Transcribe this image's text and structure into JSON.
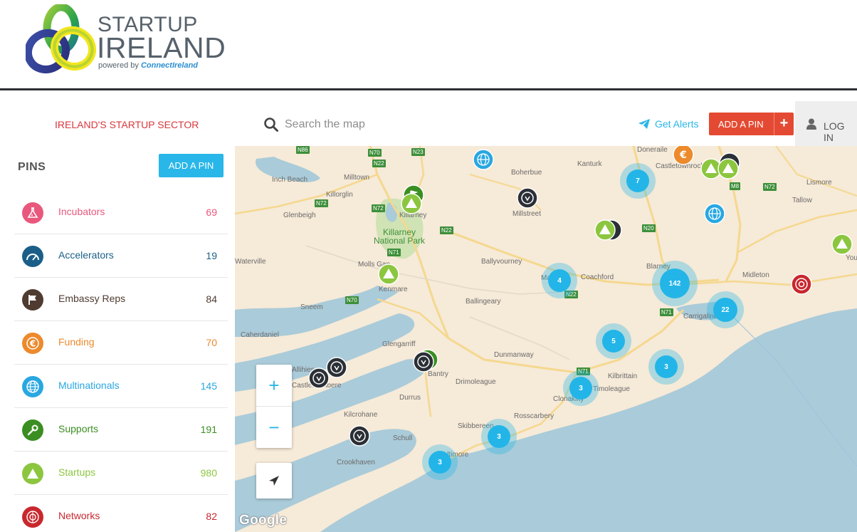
{
  "brand": {
    "line1": "STARTUP",
    "line2": "IRELAND",
    "powered_by": "powered by",
    "powered_name": "ConnectIreland"
  },
  "topbar": {
    "sector_label": "IRELAND'S STARTUP SECTOR",
    "search_placeholder": "Search the map",
    "alerts_label": "Get Alerts",
    "add_pin_label": "ADD A PIN",
    "add_pin_plus": "+",
    "login_label": "LOG IN"
  },
  "sidebar": {
    "title": "PINS",
    "add_pin_label": "ADD A PIN",
    "categories": [
      {
        "label": "Incubators",
        "count": "69",
        "color": "#e9587c",
        "icon": "flask-icon"
      },
      {
        "label": "Accelerators",
        "count": "19",
        "color": "#1b5f88",
        "icon": "speedometer-icon"
      },
      {
        "label": "Embassy Reps",
        "count": "84",
        "color": "#4f3b2f",
        "icon": "flag-icon"
      },
      {
        "label": "Funding",
        "count": "70",
        "color": "#ec8a2c",
        "icon": "euro-icon"
      },
      {
        "label": "Multinationals",
        "count": "145",
        "color": "#29a7e1",
        "icon": "globe-icon"
      },
      {
        "label": "Supports",
        "count": "191",
        "color": "#3b8e22",
        "icon": "wrench-icon"
      },
      {
        "label": "Startups",
        "count": "980",
        "color": "#8cc63f",
        "icon": "triangle-icon"
      },
      {
        "label": "Networks",
        "count": "82",
        "color": "#c8282e",
        "icon": "network-icon"
      }
    ]
  },
  "map": {
    "google_label": "Google",
    "zoom_in": "+",
    "zoom_out": "−",
    "places": [
      "Inch Beach",
      "Milltown",
      "Killorglin",
      "Glenbeigh",
      "Killarney",
      "Boherbue",
      "Kanturk",
      "Millstreet",
      "Doneraile",
      "Castletownroche",
      "Lismore",
      "Tallow",
      "Youghal",
      "Ballyvourney",
      "Molls Gap",
      "Kenmare",
      "Coachford",
      "Blarney",
      "Midleton",
      "Carrigaline",
      "Ballingeary",
      "Sneem",
      "Caherdaniel",
      "Glengarriff",
      "Dunmanway",
      "Bantry",
      "Drimoleague",
      "Durrus",
      "Kilbrittain",
      "Clonakilty",
      "Timoleague",
      "Kilcrohane",
      "Rosscarbery",
      "Schull",
      "Skibbereen",
      "Baltimore",
      "Crookhaven",
      "Waterville",
      "Castletownbere",
      "Allihies",
      "Macroom"
    ],
    "park_label_1": "Killarney",
    "park_label_2": "National Park",
    "roads": [
      "N86",
      "N70",
      "N23",
      "N22",
      "N72",
      "N72",
      "N20",
      "M8",
      "N72",
      "N71",
      "N22",
      "N70",
      "N71",
      "N71",
      "N22"
    ],
    "clusters": [
      "7",
      "4",
      "142",
      "22",
      "5",
      "3",
      "3",
      "3",
      "3"
    ]
  }
}
